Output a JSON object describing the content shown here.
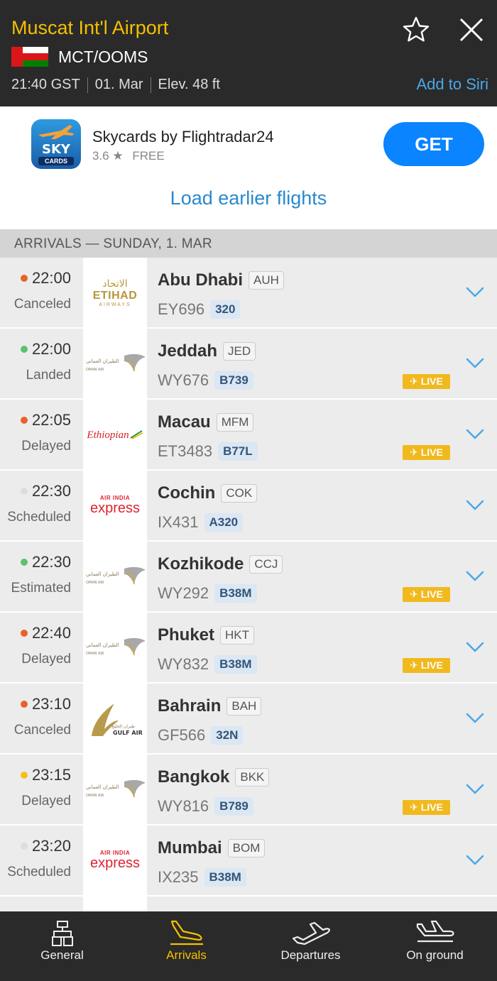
{
  "header": {
    "airport_name": "Muscat Int'l Airport",
    "code": "MCT/OOMS",
    "time": "21:40 GST",
    "date": "01. Mar",
    "elevation": "Elev. 48 ft",
    "siri": "Add to Siri"
  },
  "ad": {
    "app_name": "Skycards by Flightradar24",
    "rating": "3.6 ★",
    "price": "FREE",
    "get_label": "GET",
    "icon_text_top": "SKY",
    "icon_text_bottom": "CARDS"
  },
  "load_earlier": "Load earlier flights",
  "section_header": "ARRIVALS — SUNDAY, 1. MAR",
  "live_label": "✈ LIVE",
  "flights": [
    {
      "time": "22:00",
      "status": "Canceled",
      "dot": "#e8632a",
      "city": "Abu Dhabi",
      "iata": "AUH",
      "flight": "EY696",
      "aircraft": "320",
      "live": false,
      "airline": "etihad"
    },
    {
      "time": "22:00",
      "status": "Landed",
      "dot": "#5cc26a",
      "city": "Jeddah",
      "iata": "JED",
      "flight": "WY676",
      "aircraft": "B739",
      "live": true,
      "airline": "oman"
    },
    {
      "time": "22:05",
      "status": "Delayed",
      "dot": "#e8632a",
      "city": "Macau",
      "iata": "MFM",
      "flight": "ET3483",
      "aircraft": "B77L",
      "live": true,
      "airline": "ethiopian"
    },
    {
      "time": "22:30",
      "status": "Scheduled",
      "dot": "#dddddd",
      "city": "Cochin",
      "iata": "COK",
      "flight": "IX431",
      "aircraft": "A320",
      "live": false,
      "airline": "aie"
    },
    {
      "time": "22:30",
      "status": "Estimated",
      "dot": "#5cc26a",
      "city": "Kozhikode",
      "iata": "CCJ",
      "flight": "WY292",
      "aircraft": "B38M",
      "live": true,
      "airline": "oman"
    },
    {
      "time": "22:40",
      "status": "Delayed",
      "dot": "#e8632a",
      "city": "Phuket",
      "iata": "HKT",
      "flight": "WY832",
      "aircraft": "B38M",
      "live": true,
      "airline": "oman"
    },
    {
      "time": "23:10",
      "status": "Canceled",
      "dot": "#e8632a",
      "city": "Bahrain",
      "iata": "BAH",
      "flight": "GF566",
      "aircraft": "32N",
      "live": false,
      "airline": "gulf"
    },
    {
      "time": "23:15",
      "status": "Delayed",
      "dot": "#f2c019",
      "city": "Bangkok",
      "iata": "BKK",
      "flight": "WY816",
      "aircraft": "B789",
      "live": true,
      "airline": "oman"
    },
    {
      "time": "23:20",
      "status": "Scheduled",
      "dot": "#dddddd",
      "city": "Mumbai",
      "iata": "BOM",
      "flight": "IX235",
      "aircraft": "B38M",
      "live": false,
      "airline": "aie"
    }
  ],
  "airline_logos": {
    "etihad": {
      "arabic": "الاتحاد",
      "name": "ETIHAD",
      "sub": "AIRWAYS"
    },
    "ethiopian": {
      "name": "Ethiopian"
    },
    "aie": {
      "top": "AIR INDIA",
      "bottom": "express"
    },
    "oman": {
      "arabic": "الطيران العماني",
      "name": "OMAN AIR"
    },
    "gulf": {
      "arabic": "طيران الخليج",
      "name": "GULF AIR"
    }
  },
  "tabs": [
    {
      "label": "General",
      "icon": "tower-icon",
      "active": false
    },
    {
      "label": "Arrivals",
      "icon": "arrival-plane-icon",
      "active": true
    },
    {
      "label": "Departures",
      "icon": "departure-plane-icon",
      "active": false
    },
    {
      "label": "On ground",
      "icon": "ground-plane-icon",
      "active": false
    }
  ],
  "colors": {
    "accent": "#f5c000",
    "link": "#2a88cc",
    "live": "#f0b91d",
    "get_button": "#0a84ff"
  }
}
